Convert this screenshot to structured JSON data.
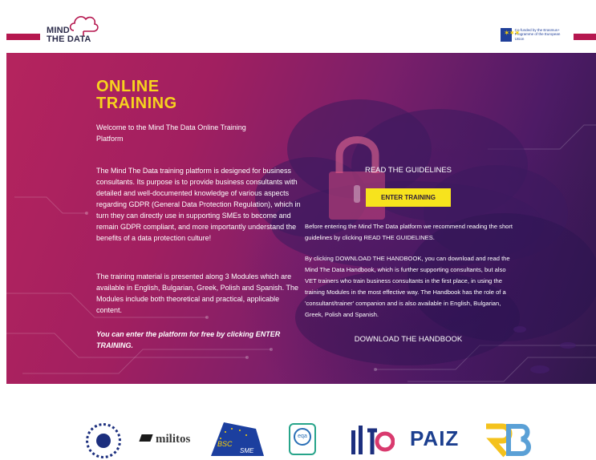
{
  "header": {
    "brand_line1": "MIND",
    "brand_line2": "THE DATA",
    "eu_text": "Co-funded by the Erasmus+ Programme of the European Union"
  },
  "hero": {
    "title_line1": "ONLINE",
    "title_line2": "TRAINING",
    "welcome": "Welcome to the Mind The Data Online Training Platform",
    "para1": "The Mind The Data training platform is designed for business consultants. Its purpose is to provide business consultants with detailed and well-documented knowledge of various aspects regarding GDPR (General Data Protection Regulation), which in turn they can directly use in supporting SMEs to become and remain GDPR compliant, and more importantly understand the benefits of a data protection culture!",
    "para2": "The training material is presented along 3 Modules which are available in English, Bulgarian, Greek, Polish and Spanish. The Modules include both theoretical and practical, applicable content.",
    "cta": "You can enter the platform for free by clicking ENTER TRAINING.",
    "read_guidelines": "READ THE GUIDELINES",
    "enter_training": "ENTER TRAINING",
    "right_para1": "Before entering the Mind The Data platform we recommend reading the short guidelines by clicking READ THE GUIDELINES.",
    "right_para2": "By clicking DOWNLOAD THE HANDBOOK, you can download and read the Mind The Data Handbook, which is further supporting consultants, but also VET trainers who train business consultants in the first place, in using the training Modules in the most effective way. The Handbook has the role of a 'consultant/trainer' companion and is also available in English, Bulgarian, Greek, Polish and Spanish.",
    "download_handbook": "DOWNLOAD THE HANDBOOK"
  },
  "partners": {
    "militos": "militos",
    "bsc": "BSC SME",
    "eqa": "eqa",
    "paiz": "PAIZ"
  },
  "colors": {
    "accent_magenta": "#b5174f",
    "title_yellow": "#f7d31e",
    "button_yellow": "#f7e31d"
  }
}
